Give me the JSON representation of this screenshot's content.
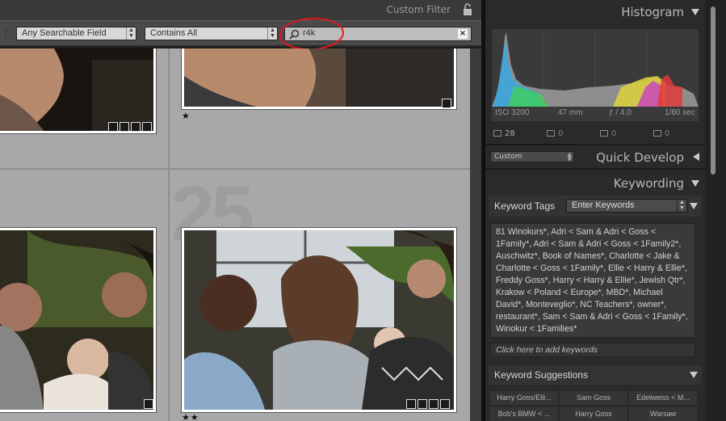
{
  "filter_bar": {
    "title": "Custom Filter",
    "field_select": "Any Searchable Field",
    "rule_select": "Contains All",
    "search_value": "r4k",
    "clear_label": "×"
  },
  "grid": {
    "watermark": "25",
    "cells": [
      {
        "stars": ""
      },
      {
        "stars": "★"
      },
      {
        "stars": ""
      },
      {
        "stars": "★★"
      }
    ]
  },
  "histogram": {
    "title": "Histogram",
    "iso": "ISO 3200",
    "focal": "47 mm",
    "aperture": "ƒ / 4.0",
    "shutter": "1/80 sec",
    "tools": [
      {
        "icon": "crop-icon",
        "count": "28"
      },
      {
        "icon": "spot-icon",
        "count": "0"
      },
      {
        "icon": "redeye-icon",
        "count": "0"
      },
      {
        "icon": "grad-icon",
        "count": "0"
      }
    ]
  },
  "quick_develop": {
    "title": "Quick Develop",
    "preset": "Custom"
  },
  "keywording": {
    "title": "Keywording",
    "tags_label": "Keyword Tags",
    "tags_select": "Enter Keywords",
    "keywords_text": "81 Winokurs*, Adri < Sam & Adri < Goss < 1Family*, Adri < Sam & Adri < Goss < 1Family2*, Auschwitz*, Book of Names*, Charlotte < Jake & Charlotte < Goss < 1Family*, Ellie < Harry & Ellie*, Freddy Goss*, Harry < Harry & Ellie*, Jewish Qtr*, Krakow < Poland < Europe*, MBD*, Michael David*, Monteveglio*, NC Teachers*, owner*, restaurant*, Sam < Sam & Adri < Goss < 1Family*, Winokur < 1Families*",
    "add_placeholder": "Click here to add keywords",
    "suggestions_label": "Keyword Suggestions",
    "suggestions": [
      "Harry Goss/Elli...",
      "Sam Goss",
      "Edelweiss < M...",
      "Bob's BMW < ...",
      "Harry Goss",
      "Warsaw"
    ]
  },
  "colors": {
    "accent_annotation": "#e5151c",
    "panel_bg": "#2a2a2a",
    "grid_bg": "#b2b2b2"
  }
}
